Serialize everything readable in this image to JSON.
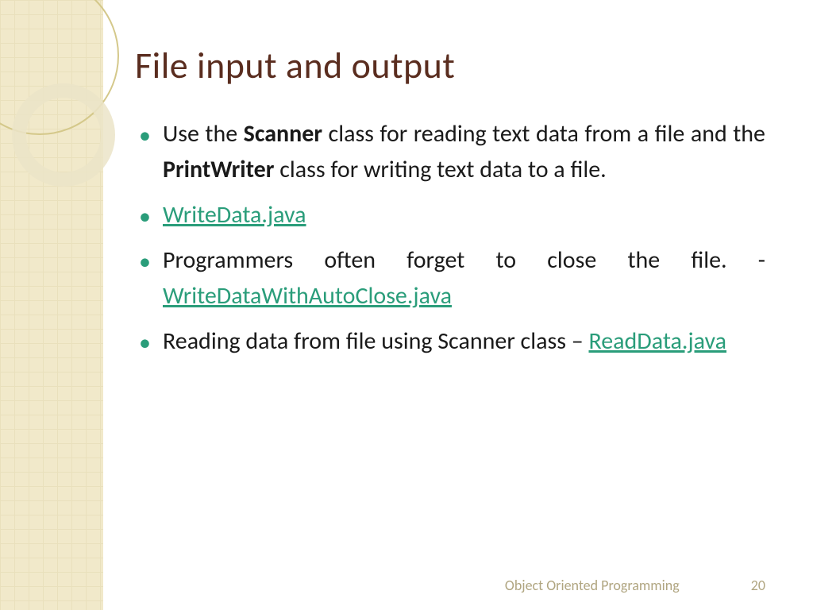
{
  "title": "File input and output",
  "bullets": {
    "item1_part1": "Use the ",
    "item1_bold1": "Scanner",
    "item1_part2": " class for reading text data from a file and the ",
    "item1_bold2": "PrintWriter",
    "item1_part3": " class for writing text data to a file.",
    "item2_link": "WriteData.java",
    "item3_part1": "Programmers often forget to close the file.  - ",
    "item3_link": "WriteDataWithAutoClose.java",
    "item4_part1": "Reading data from file using Scanner class – ",
    "item4_link": "ReadData.java"
  },
  "footer": {
    "course": "Object Oriented Programming",
    "page": "20"
  }
}
